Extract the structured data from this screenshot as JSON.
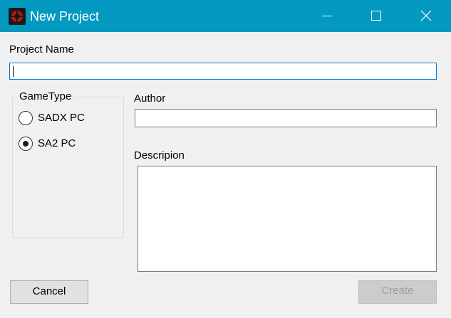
{
  "window": {
    "title": "New Project",
    "controls": [
      "minimize-icon",
      "maximize-icon",
      "close-icon"
    ],
    "titlebar_color": "#0399c0"
  },
  "form": {
    "project_name_label": "Project Name",
    "project_name_value": "",
    "gametype": {
      "legend": "GameType",
      "options": [
        {
          "label": "SADX PC",
          "selected": false
        },
        {
          "label": "SA2 PC",
          "selected": true
        }
      ]
    },
    "author_label": "Author",
    "author_value": "",
    "description_label": "Descripion",
    "description_value": ""
  },
  "buttons": {
    "cancel_label": "Cancel",
    "create_label": "Create",
    "create_enabled": false
  }
}
